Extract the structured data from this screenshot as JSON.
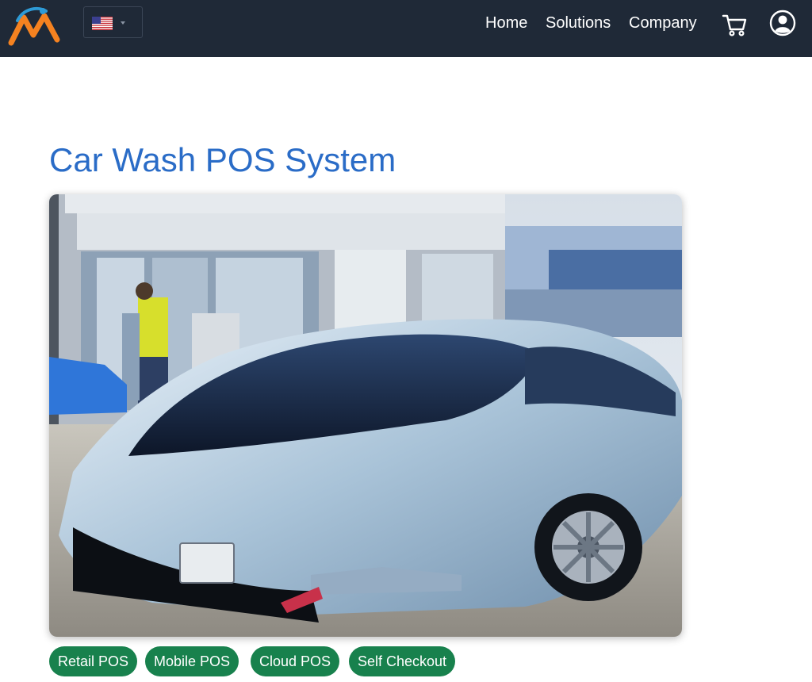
{
  "header": {
    "logo_icon": "brand-m-logo-icon",
    "language": {
      "selected_icon": "us-flag-icon",
      "dropdown_icon": "caret-down-icon"
    },
    "nav": [
      {
        "label": "Home"
      },
      {
        "label": "Solutions"
      },
      {
        "label": "Company"
      }
    ],
    "cart_icon": "shopping-cart-icon",
    "account_icon": "user-circle-icon"
  },
  "main": {
    "title": "Car Wash POS System",
    "hero_image": "futuristic silver car parked at a service station",
    "tags": [
      {
        "label": "Retail POS"
      },
      {
        "label": "Mobile POS"
      },
      {
        "label": "Cloud POS"
      },
      {
        "label": "Self Checkout"
      }
    ]
  },
  "colors": {
    "navbar": "#1f2937",
    "title": "#2a6cc7",
    "tag": "#18814d",
    "logo_orange": "#f58220",
    "logo_blue": "#2e9bd6"
  }
}
